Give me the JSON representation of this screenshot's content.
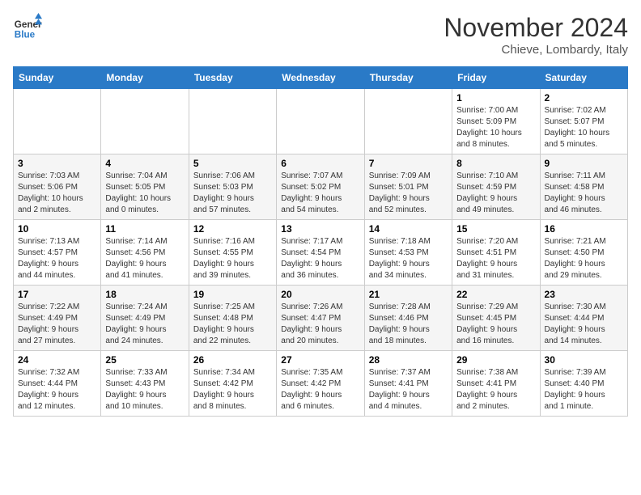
{
  "header": {
    "logo_line1": "General",
    "logo_line2": "Blue",
    "month_title": "November 2024",
    "location": "Chieve, Lombardy, Italy"
  },
  "weekdays": [
    "Sunday",
    "Monday",
    "Tuesday",
    "Wednesday",
    "Thursday",
    "Friday",
    "Saturday"
  ],
  "weeks": [
    [
      {
        "day": "",
        "info": ""
      },
      {
        "day": "",
        "info": ""
      },
      {
        "day": "",
        "info": ""
      },
      {
        "day": "",
        "info": ""
      },
      {
        "day": "",
        "info": ""
      },
      {
        "day": "1",
        "info": "Sunrise: 7:00 AM\nSunset: 5:09 PM\nDaylight: 10 hours\nand 8 minutes."
      },
      {
        "day": "2",
        "info": "Sunrise: 7:02 AM\nSunset: 5:07 PM\nDaylight: 10 hours\nand 5 minutes."
      }
    ],
    [
      {
        "day": "3",
        "info": "Sunrise: 7:03 AM\nSunset: 5:06 PM\nDaylight: 10 hours\nand 2 minutes."
      },
      {
        "day": "4",
        "info": "Sunrise: 7:04 AM\nSunset: 5:05 PM\nDaylight: 10 hours\nand 0 minutes."
      },
      {
        "day": "5",
        "info": "Sunrise: 7:06 AM\nSunset: 5:03 PM\nDaylight: 9 hours\nand 57 minutes."
      },
      {
        "day": "6",
        "info": "Sunrise: 7:07 AM\nSunset: 5:02 PM\nDaylight: 9 hours\nand 54 minutes."
      },
      {
        "day": "7",
        "info": "Sunrise: 7:09 AM\nSunset: 5:01 PM\nDaylight: 9 hours\nand 52 minutes."
      },
      {
        "day": "8",
        "info": "Sunrise: 7:10 AM\nSunset: 4:59 PM\nDaylight: 9 hours\nand 49 minutes."
      },
      {
        "day": "9",
        "info": "Sunrise: 7:11 AM\nSunset: 4:58 PM\nDaylight: 9 hours\nand 46 minutes."
      }
    ],
    [
      {
        "day": "10",
        "info": "Sunrise: 7:13 AM\nSunset: 4:57 PM\nDaylight: 9 hours\nand 44 minutes."
      },
      {
        "day": "11",
        "info": "Sunrise: 7:14 AM\nSunset: 4:56 PM\nDaylight: 9 hours\nand 41 minutes."
      },
      {
        "day": "12",
        "info": "Sunrise: 7:16 AM\nSunset: 4:55 PM\nDaylight: 9 hours\nand 39 minutes."
      },
      {
        "day": "13",
        "info": "Sunrise: 7:17 AM\nSunset: 4:54 PM\nDaylight: 9 hours\nand 36 minutes."
      },
      {
        "day": "14",
        "info": "Sunrise: 7:18 AM\nSunset: 4:53 PM\nDaylight: 9 hours\nand 34 minutes."
      },
      {
        "day": "15",
        "info": "Sunrise: 7:20 AM\nSunset: 4:51 PM\nDaylight: 9 hours\nand 31 minutes."
      },
      {
        "day": "16",
        "info": "Sunrise: 7:21 AM\nSunset: 4:50 PM\nDaylight: 9 hours\nand 29 minutes."
      }
    ],
    [
      {
        "day": "17",
        "info": "Sunrise: 7:22 AM\nSunset: 4:49 PM\nDaylight: 9 hours\nand 27 minutes."
      },
      {
        "day": "18",
        "info": "Sunrise: 7:24 AM\nSunset: 4:49 PM\nDaylight: 9 hours\nand 24 minutes."
      },
      {
        "day": "19",
        "info": "Sunrise: 7:25 AM\nSunset: 4:48 PM\nDaylight: 9 hours\nand 22 minutes."
      },
      {
        "day": "20",
        "info": "Sunrise: 7:26 AM\nSunset: 4:47 PM\nDaylight: 9 hours\nand 20 minutes."
      },
      {
        "day": "21",
        "info": "Sunrise: 7:28 AM\nSunset: 4:46 PM\nDaylight: 9 hours\nand 18 minutes."
      },
      {
        "day": "22",
        "info": "Sunrise: 7:29 AM\nSunset: 4:45 PM\nDaylight: 9 hours\nand 16 minutes."
      },
      {
        "day": "23",
        "info": "Sunrise: 7:30 AM\nSunset: 4:44 PM\nDaylight: 9 hours\nand 14 minutes."
      }
    ],
    [
      {
        "day": "24",
        "info": "Sunrise: 7:32 AM\nSunset: 4:44 PM\nDaylight: 9 hours\nand 12 minutes."
      },
      {
        "day": "25",
        "info": "Sunrise: 7:33 AM\nSunset: 4:43 PM\nDaylight: 9 hours\nand 10 minutes."
      },
      {
        "day": "26",
        "info": "Sunrise: 7:34 AM\nSunset: 4:42 PM\nDaylight: 9 hours\nand 8 minutes."
      },
      {
        "day": "27",
        "info": "Sunrise: 7:35 AM\nSunset: 4:42 PM\nDaylight: 9 hours\nand 6 minutes."
      },
      {
        "day": "28",
        "info": "Sunrise: 7:37 AM\nSunset: 4:41 PM\nDaylight: 9 hours\nand 4 minutes."
      },
      {
        "day": "29",
        "info": "Sunrise: 7:38 AM\nSunset: 4:41 PM\nDaylight: 9 hours\nand 2 minutes."
      },
      {
        "day": "30",
        "info": "Sunrise: 7:39 AM\nSunset: 4:40 PM\nDaylight: 9 hours\nand 1 minute."
      }
    ]
  ]
}
